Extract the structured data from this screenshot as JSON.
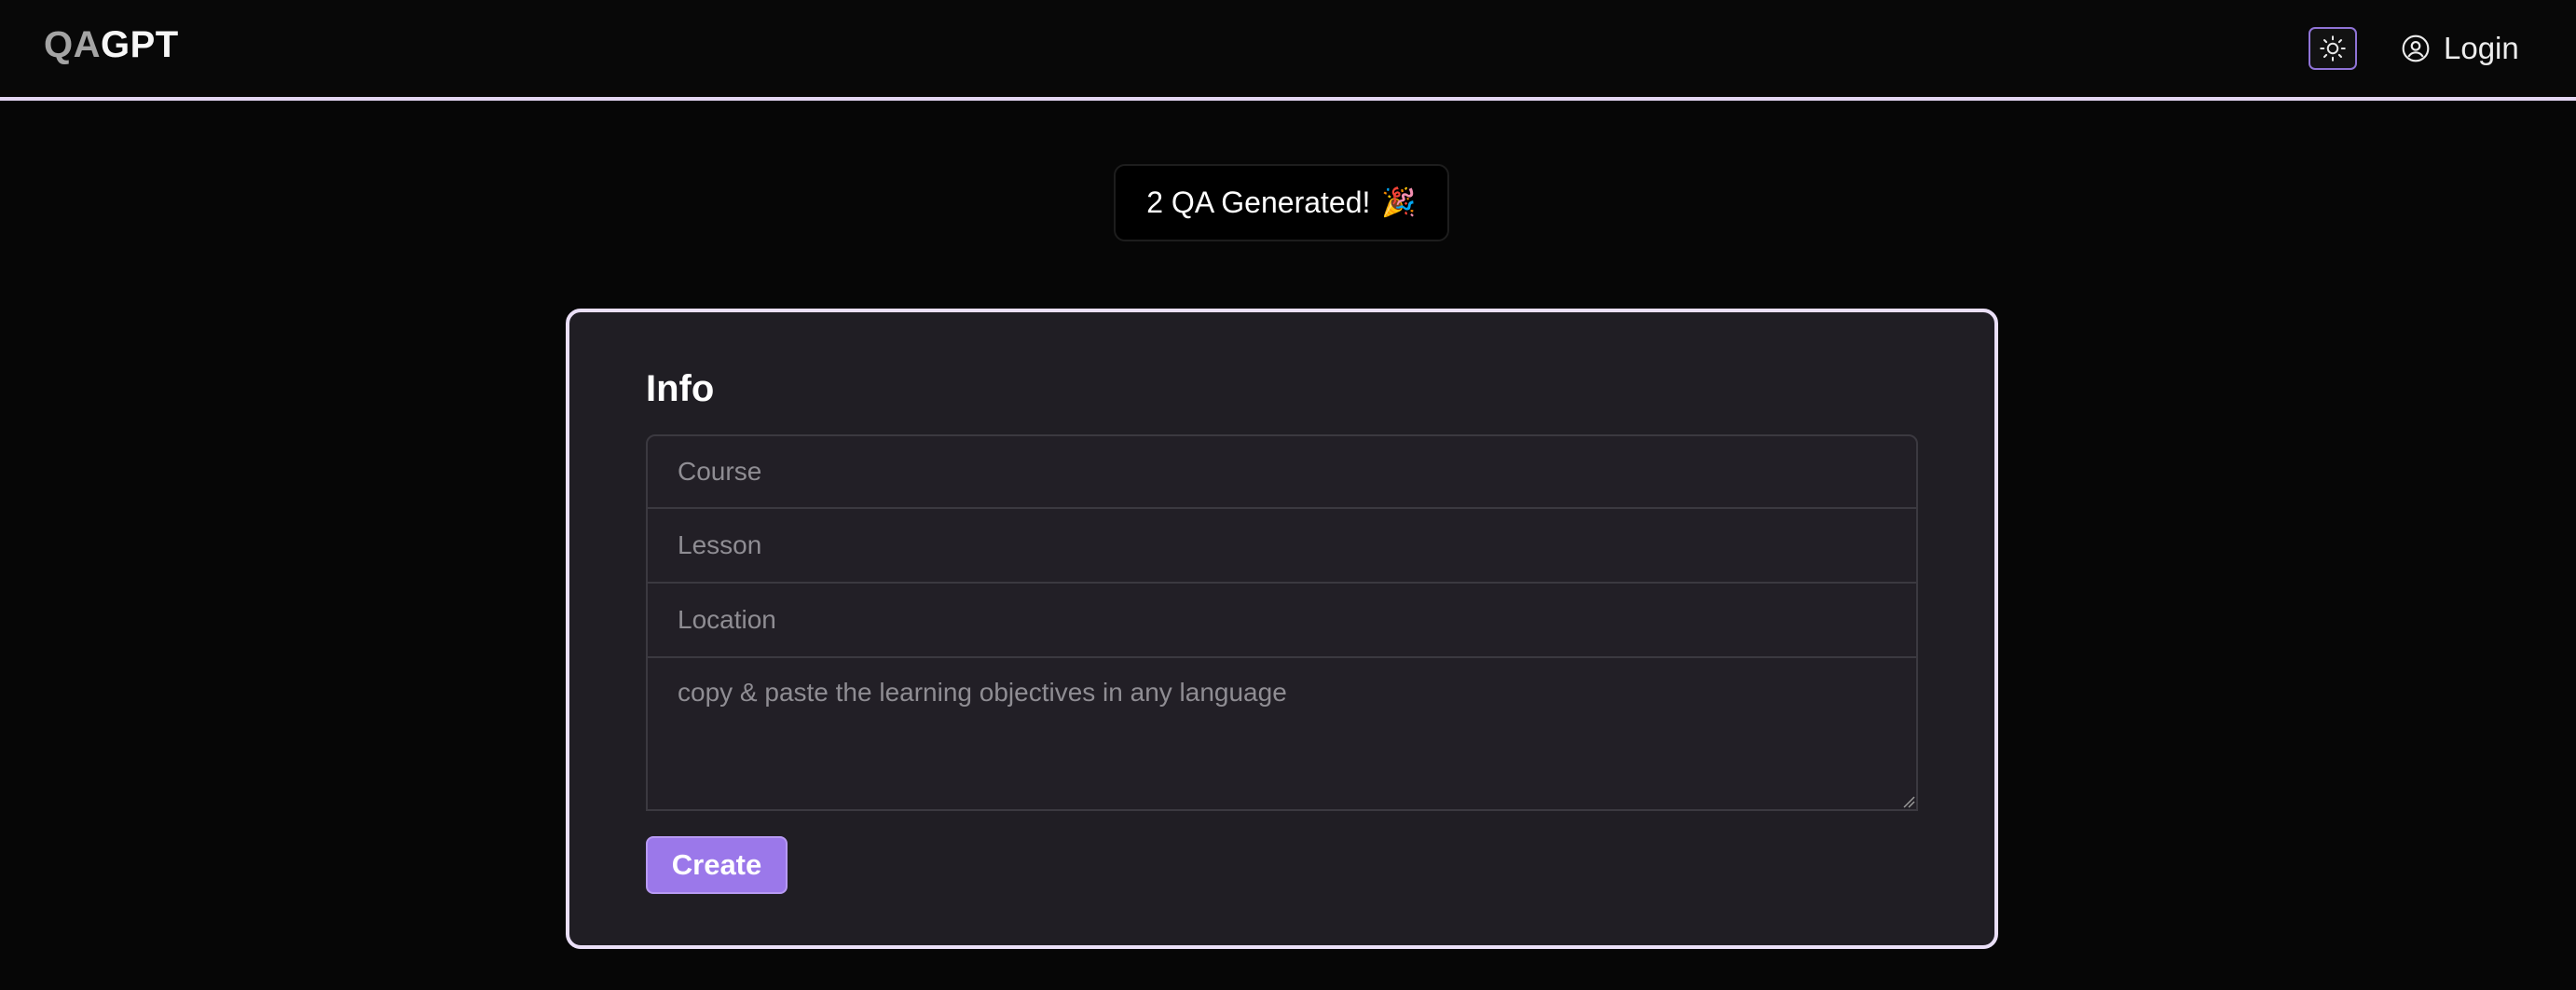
{
  "header": {
    "logo_part1": "QA",
    "logo_part2": "GPT",
    "theme_toggle_icon": "sun-icon",
    "login_icon": "user-circle-icon",
    "login_label": "Login"
  },
  "toast": {
    "message": "2 QA Generated!",
    "emoji": "🎉"
  },
  "form": {
    "title": "Info",
    "course_placeholder": "Course",
    "course_value": "",
    "lesson_placeholder": "Lesson",
    "lesson_value": "",
    "location_placeholder": "Location",
    "location_value": "",
    "objectives_placeholder": "copy & paste the learning objectives in any language",
    "objectives_value": "",
    "create_label": "Create"
  },
  "colors": {
    "background": "#060606",
    "accent": "#9b78ea",
    "card_border": "#eadff7",
    "card_background": "#201e24"
  }
}
